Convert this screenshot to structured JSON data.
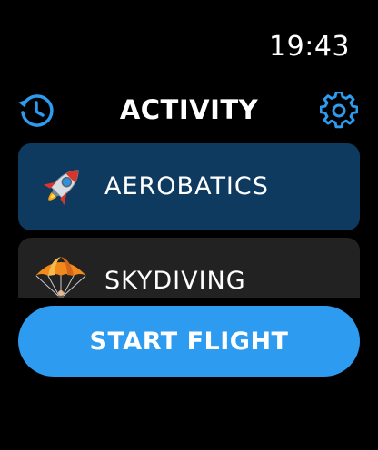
{
  "status": {
    "time": "19:43"
  },
  "header": {
    "title": "ACTIVITY",
    "left_icon": "history-clock-icon",
    "right_icon": "gear-icon"
  },
  "activities": [
    {
      "label": "AEROBATICS",
      "icon": "rocket-icon",
      "selected": true
    },
    {
      "label": "SKYDIVING",
      "icon": "parachute-icon",
      "selected": false
    }
  ],
  "start_button": {
    "label": "START FLIGHT"
  },
  "colors": {
    "accent": "#2d9bf0",
    "selected_row": "#0f3a60",
    "row": "#222222",
    "background": "#000000"
  }
}
